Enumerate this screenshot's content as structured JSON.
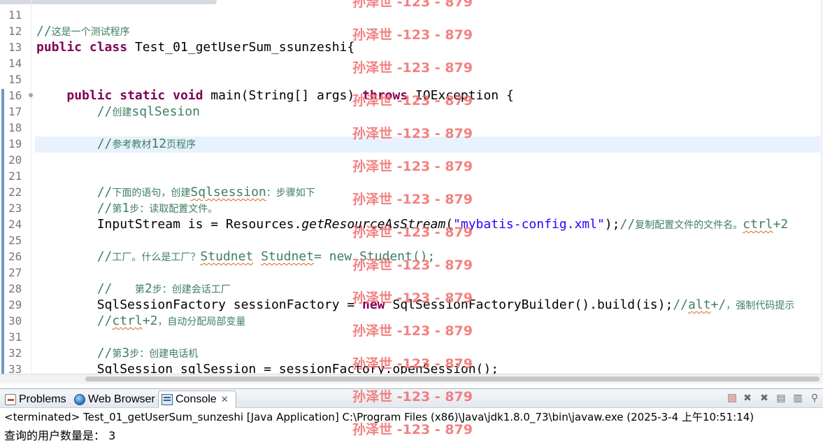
{
  "editor": {
    "lines": [
      {
        "n": "11",
        "parts": []
      },
      {
        "n": "12",
        "parts": [
          [
            "cm",
            "//这是一个测试程序"
          ]
        ]
      },
      {
        "n": "13",
        "parts": [
          [
            "kw",
            "public"
          ],
          [
            "",
            " "
          ],
          [
            "kw",
            "class"
          ],
          [
            "",
            " Test_01_getUserSum_ssunzeshi{"
          ]
        ]
      },
      {
        "n": "14",
        "parts": []
      },
      {
        "n": "15",
        "parts": []
      },
      {
        "n": "16",
        "fold": true,
        "parts": [
          [
            "",
            "    "
          ],
          [
            "kw",
            "public"
          ],
          [
            "",
            " "
          ],
          [
            "kw",
            "static"
          ],
          [
            "",
            " "
          ],
          [
            "kw",
            "void"
          ],
          [
            "",
            " main(String[] args) "
          ],
          [
            "kw",
            "throws"
          ],
          [
            "",
            " IOException {"
          ]
        ]
      },
      {
        "n": "17",
        "parts": [
          [
            "",
            "        "
          ],
          [
            "cm",
            "//创建sqlSesion"
          ]
        ]
      },
      {
        "n": "18",
        "parts": []
      },
      {
        "n": "19",
        "parts": [
          [
            "",
            "        "
          ],
          [
            "cm",
            "//参考教材12页程序"
          ]
        ]
      },
      {
        "n": "20",
        "parts": []
      },
      {
        "n": "21",
        "parts": []
      },
      {
        "n": "22",
        "parts": [
          [
            "",
            "        "
          ],
          [
            "cm",
            "//下面的语句，创建"
          ],
          [
            "cm squig",
            "Sqlsession"
          ],
          [
            "cm",
            "：步骤如下"
          ]
        ]
      },
      {
        "n": "23",
        "parts": [
          [
            "",
            "        "
          ],
          [
            "cm",
            "//第1步：读取配置文件。"
          ]
        ]
      },
      {
        "n": "24",
        "parts": [
          [
            "",
            "        InputStream is = Resources."
          ],
          [
            "it",
            "getResourceAsStream"
          ],
          [
            "",
            "("
          ],
          [
            "str",
            "\"mybatis-config.xml\""
          ],
          [
            "",
            ");"
          ],
          [
            "cm",
            "//复制配置文件的文件名。"
          ],
          [
            "cm squig",
            "ctrl"
          ],
          [
            "cm",
            "+2"
          ]
        ]
      },
      {
        "n": "25",
        "parts": []
      },
      {
        "n": "26",
        "parts": [
          [
            "",
            "        "
          ],
          [
            "cm",
            "//工厂。什么是工厂？"
          ],
          [
            "cm squig",
            "Studnet"
          ],
          [
            "cm",
            " "
          ],
          [
            "cm squig",
            "Studnet"
          ],
          [
            "cm",
            "= new Student();"
          ]
        ]
      },
      {
        "n": "27",
        "parts": []
      },
      {
        "n": "28",
        "parts": [
          [
            "",
            "        "
          ],
          [
            "cm",
            "//   第2步：创建会话工厂"
          ]
        ]
      },
      {
        "n": "29",
        "parts": [
          [
            "",
            "        SqlSessionFactory sessionFactory = "
          ],
          [
            "kw",
            "new"
          ],
          [
            "",
            " SqlSessionFactoryBuilder().build(is);"
          ],
          [
            "cm",
            "//"
          ],
          [
            "cm squig",
            "alt"
          ],
          [
            "cm",
            "+/，强制代码提示"
          ]
        ]
      },
      {
        "n": "30",
        "parts": [
          [
            "",
            "        "
          ],
          [
            "cm",
            "//"
          ],
          [
            "cm squig",
            "ctrl"
          ],
          [
            "cm",
            "+2，自动分配局部变量"
          ]
        ]
      },
      {
        "n": "31",
        "parts": []
      },
      {
        "n": "32",
        "parts": [
          [
            "",
            "        "
          ],
          [
            "cm",
            "//第3步：创建电话机"
          ]
        ]
      },
      {
        "n": "33",
        "parts": [
          [
            "",
            "        SqlSession sqlSession = sessionFactory.openSession();"
          ]
        ]
      }
    ]
  },
  "console_panel": {
    "tabs": [
      {
        "label": "Problems",
        "icon": "problems-icon"
      },
      {
        "label": "Web Browser",
        "icon": "globe-icon"
      },
      {
        "label": "Console",
        "icon": "console-icon",
        "active": true
      }
    ],
    "close_glyph": "✕",
    "status": "<terminated> Test_01_getUserSum_sunzeshi [Java Application] C:\\Program Files (x86)\\Java\\jdk1.8.0_73\\bin\\javaw.exe (2025-3-4 上午10:51:14)",
    "output": "查询的用户数量是： 3"
  },
  "watermark": {
    "text": "孙泽世 -123 - 879",
    "color": "#f26c6c"
  }
}
